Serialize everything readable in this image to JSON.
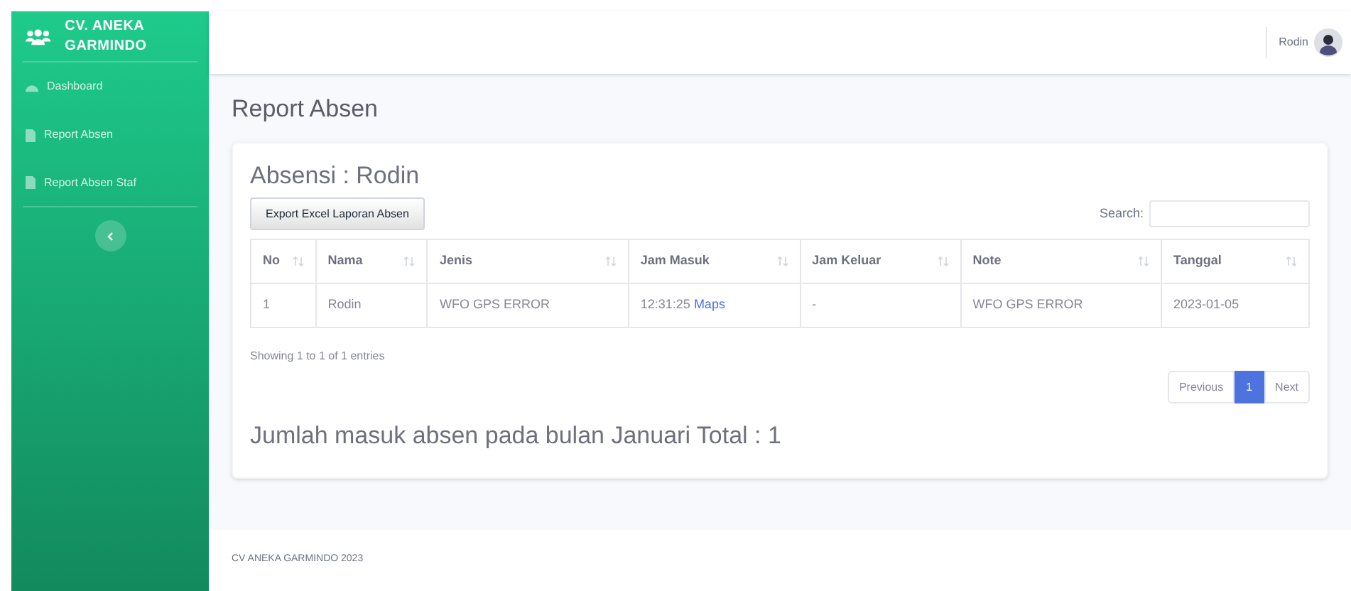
{
  "brand": {
    "name": "CV. ANEKA GARMINDO"
  },
  "sidebar": {
    "items": [
      {
        "label": "Dashboard",
        "kind": "gauge"
      },
      {
        "label": "Report Absen",
        "kind": "file"
      },
      {
        "label": "Report Absen Staf",
        "kind": "file"
      }
    ]
  },
  "topbar": {
    "user": "Rodin"
  },
  "page_title": "Report Absen",
  "card": {
    "title": "Absensi : Rodin",
    "export_button": "Export Excel Laporan Absen",
    "search_label": "Search:",
    "table": {
      "columns": [
        "No",
        "Nama",
        "Jenis",
        "Jam Masuk",
        "Jam Keluar",
        "Note",
        "Tanggal"
      ],
      "rows": [
        {
          "cells": [
            "1",
            "Rodin",
            "WFO GPS ERROR",
            "12:31:25",
            "-",
            "WFO GPS ERROR",
            "2023-01-05"
          ],
          "link": "Maps"
        }
      ]
    },
    "info": "Showing 1 to 1 of 1 entries",
    "pagination": [
      {
        "label": "Previous",
        "selected": false
      },
      {
        "label": "1",
        "selected": true
      },
      {
        "label": "Next",
        "selected": false
      }
    ],
    "summary": "Jumlah masuk absen pada bulan Januari Total : 1"
  },
  "footer": "CV ANEKA GARMINDO 2023"
}
